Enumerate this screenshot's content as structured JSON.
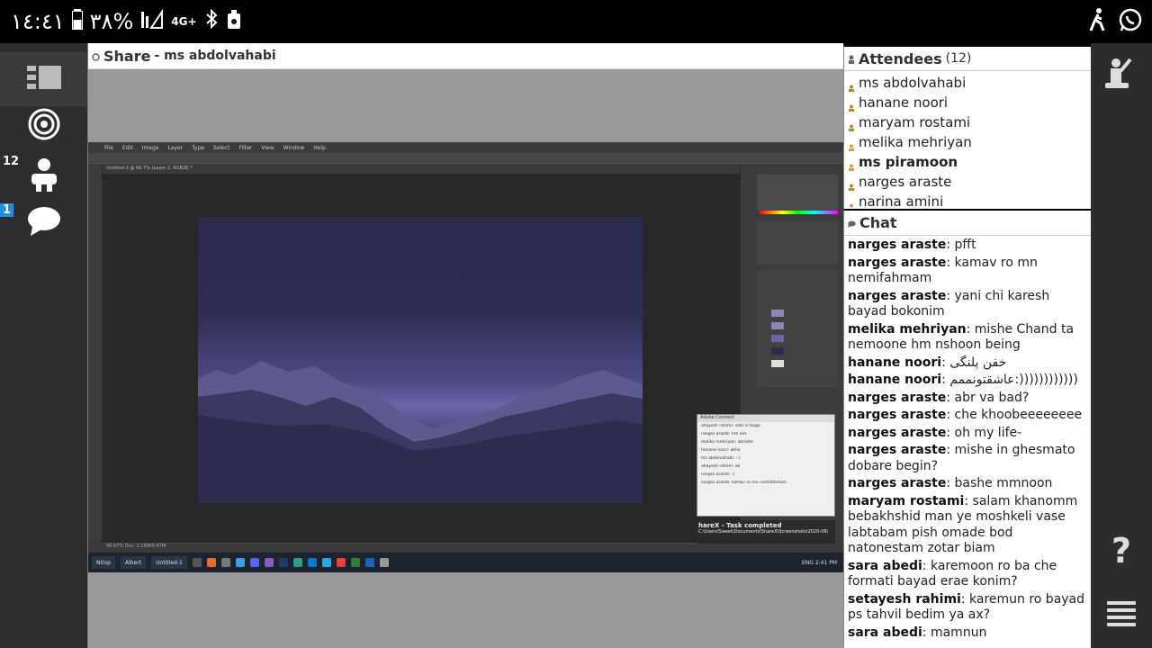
{
  "statusbar": {
    "time": "١٤:٤١",
    "battery": "٣٨%",
    "network": "4G+"
  },
  "left_rail": {
    "attendee_badge": "12",
    "chat_badge": "1"
  },
  "share": {
    "title": "Share",
    "presenter": "- ms abdolvahabi"
  },
  "ps": {
    "menu": [
      "File",
      "Edit",
      "Image",
      "Layer",
      "Type",
      "Select",
      "Filter",
      "View",
      "Window",
      "Help"
    ],
    "doc_tab": "Untitled-1 @ 66.7% (Layer 2, RGB/8) *",
    "status": "66.67%      Doc: 2.25M/9.67M",
    "mini_chat": {
      "header": "Adobe Connect",
      "lines": [
        "ahayesh rahimi: sabr ki bega",
        "narges araste: hm nes",
        "melika mehriyan: doroste",
        "hanane noori: akhe",
        "ms abdolvahabi: :-)",
        "ahayesh rahimi: ok",
        "narges araste: :)",
        "narges araste: kamav ro mn nemifahmam"
      ]
    },
    "notif_title": "hareX - Task completed",
    "notif_body": "C:\\Users\\Sweet\\Documents\\ShareX\\Screenshots\\2020-06\\",
    "taskbar": {
      "items": [
        "Nitop",
        "Albert",
        "Untitled-1"
      ],
      "tray": "ENG  2:41 PM"
    }
  },
  "attendees": {
    "title": "Attendees",
    "count": "(12)",
    "items": [
      {
        "name": "ms abdolvahabi",
        "bold": false
      },
      {
        "name": "hanane noori",
        "bold": false
      },
      {
        "name": "maryam rostami",
        "bold": false
      },
      {
        "name": "melika mehriyan",
        "bold": false
      },
      {
        "name": "ms piramoon",
        "bold": true
      },
      {
        "name": "narges araste",
        "bold": false
      },
      {
        "name": "narina amini",
        "bold": false
      }
    ]
  },
  "chat": {
    "title": "Chat",
    "messages": [
      {
        "sender": "narges araste",
        "text": ": pfft"
      },
      {
        "sender": "narges araste",
        "text": ": kamav ro mn nemifahmam"
      },
      {
        "sender": "narges araste",
        "text": ": yani chi karesh bayad bokonim"
      },
      {
        "sender": "melika mehriyan",
        "text": ": mishe Chand ta nemoone hm nshoon being"
      },
      {
        "sender": "hanane noori",
        "text": ": خفن پلنگی"
      },
      {
        "sender": "hanane noori",
        "text": ": عاشقتونممم:))))))))))))"
      },
      {
        "sender": "narges araste",
        "text": ": abr va bad?"
      },
      {
        "sender": "narges araste",
        "text": ": che khoobeeeeeeee"
      },
      {
        "sender": "narges araste",
        "text": ": oh my life-"
      },
      {
        "sender": "narges araste",
        "text": ": mishe in ghesmato dobare begin?"
      },
      {
        "sender": "narges araste",
        "text": ": bashe mmnoon"
      },
      {
        "sender": "maryam rostami",
        "text": ": salam khanomm bebakhshid man ye moshkeli vase labtabam pish omade bod natonestam zotar biam"
      },
      {
        "sender": "sara abedi",
        "text": ": karemoon ro ba che formati bayad erae konim?"
      },
      {
        "sender": "setayesh rahimi",
        "text": ": karemun ro bayad ps tahvil bedim ya ax?"
      },
      {
        "sender": "sara abedi",
        "text": ": mamnun"
      }
    ]
  },
  "right_rail": {
    "help": "?"
  },
  "colors": {
    "accent_blue": "#1e8fe0",
    "rail_bg": "#2e2e2e",
    "share_bg": "#999999"
  }
}
